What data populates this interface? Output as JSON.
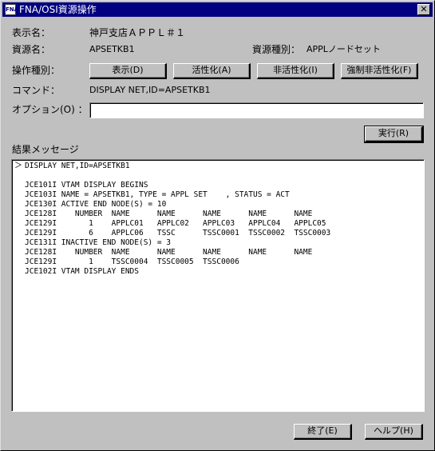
{
  "window": {
    "title": "FNA/OSI資源操作",
    "close_glyph": "✕",
    "icon_text": "FNA"
  },
  "fields": {
    "display_name_label": "表示名：",
    "display_name_value": "神戸支店ＡＰＰＬ＃１",
    "resource_name_label": "資源名：",
    "resource_name_value": "APSETKB1",
    "resource_type_label": "資源種別：",
    "resource_type_value": "APPLノードセット",
    "operation_type_label": "操作種別：",
    "command_label": "コマンド：",
    "command_value": "DISPLAY NET,ID=APSETKB1",
    "option_label": "オプション(O) ：",
    "option_value": ""
  },
  "operations": {
    "display": "表示(D)",
    "activate": "活性化(A)",
    "deactivate": "非活性化(I)",
    "force_deactivate": "強制非活性化(F)"
  },
  "execute_label": "実行(R)",
  "results": {
    "label": "結果メッセージ",
    "prompt_glyph": "＞",
    "lines": [
      "DISPLAY NET,ID=APSETKB1",
      "",
      "JCE101I VTAM DISPLAY BEGINS",
      "JCE103I NAME = APSETKB1, TYPE = APPL SET    , STATUS = ACT",
      "JCE130I ACTIVE END NODE(S) = 10",
      "JCE128I    NUMBER  NAME      NAME      NAME      NAME      NAME",
      "JCE129I       1    APPLC01   APPLC02   APPLC03   APPLC04   APPLC05",
      "JCE129I       6    APPLC06   TSSC      TSSC0001  TSSC0002  TSSC0003",
      "JCE131I INACTIVE END NODE(S) = 3",
      "JCE128I    NUMBER  NAME      NAME      NAME      NAME      NAME",
      "JCE129I       1    TSSC0004  TSSC0005  TSSC0006",
      "JCE102I VTAM DISPLAY ENDS"
    ]
  },
  "footer": {
    "close_label": "終了(E)",
    "help_label": "ヘルプ(H)"
  }
}
